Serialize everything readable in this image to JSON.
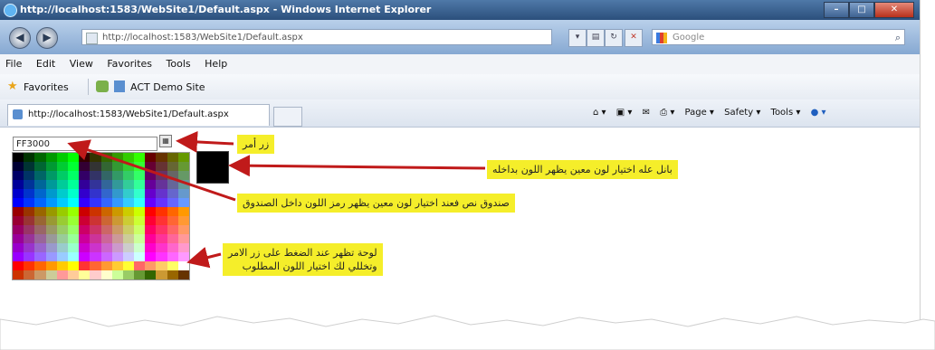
{
  "browser": {
    "title": "http://localhost:1583/WebSite1/Default.aspx - Windows Internet Explorer",
    "address": "http://localhost:1583/WebSite1/Default.aspx",
    "search_placeholder": "Google",
    "menu": [
      "File",
      "Edit",
      "View",
      "Favorites",
      "Tools",
      "Help"
    ],
    "favorites_label": "Favorites",
    "favorite_site": "ACT Demo Site",
    "tab_title": "http://localhost:1583/WebSite1/Default.aspx",
    "commands": [
      "Page ▾",
      "Safety ▾",
      "Tools ▾"
    ]
  },
  "page": {
    "color_value": "FF3000",
    "picker_button_label": "▦",
    "sample_color": "#000000",
    "palette_rows": [
      [
        "#000000",
        "#003300",
        "#006600",
        "#009900",
        "#00cc00",
        "#00ff00",
        "#330000",
        "#333300",
        "#336600",
        "#339900",
        "#33cc00",
        "#33ff00",
        "#660000",
        "#663300",
        "#666600",
        "#669900"
      ],
      [
        "#000033",
        "#003333",
        "#006633",
        "#009933",
        "#00cc33",
        "#00ff33",
        "#330033",
        "#333333",
        "#336633",
        "#339933",
        "#33cc33",
        "#33ff33",
        "#660033",
        "#663333",
        "#666633",
        "#669933"
      ],
      [
        "#000066",
        "#003366",
        "#006666",
        "#009966",
        "#00cc66",
        "#00ff66",
        "#330066",
        "#333366",
        "#336666",
        "#339966",
        "#33cc66",
        "#33ff66",
        "#660066",
        "#663366",
        "#666666",
        "#669966"
      ],
      [
        "#000099",
        "#003399",
        "#006699",
        "#009999",
        "#00cc99",
        "#00ff99",
        "#330099",
        "#333399",
        "#336699",
        "#339999",
        "#33cc99",
        "#33ff99",
        "#660099",
        "#663399",
        "#666699",
        "#669999"
      ],
      [
        "#0000cc",
        "#0033cc",
        "#0066cc",
        "#0099cc",
        "#00cccc",
        "#00ffcc",
        "#3300cc",
        "#3333cc",
        "#3366cc",
        "#3399cc",
        "#33cccc",
        "#33ffcc",
        "#6600cc",
        "#6633cc",
        "#6666cc",
        "#6699cc"
      ],
      [
        "#0000ff",
        "#0033ff",
        "#0066ff",
        "#0099ff",
        "#00ccff",
        "#00ffff",
        "#3300ff",
        "#3333ff",
        "#3366ff",
        "#3399ff",
        "#33ccff",
        "#33ffff",
        "#6600ff",
        "#6633ff",
        "#6666ff",
        "#6699ff"
      ],
      [
        "#990000",
        "#993300",
        "#996600",
        "#999900",
        "#99cc00",
        "#99ff00",
        "#cc0000",
        "#cc3300",
        "#cc6600",
        "#cc9900",
        "#cccc00",
        "#ccff00",
        "#ff0000",
        "#ff3300",
        "#ff6600",
        "#ff9900"
      ],
      [
        "#990033",
        "#993333",
        "#996633",
        "#999933",
        "#99cc33",
        "#99ff33",
        "#cc0033",
        "#cc3333",
        "#cc6633",
        "#cc9933",
        "#cccc33",
        "#ccff33",
        "#ff0033",
        "#ff3333",
        "#ff6633",
        "#ff9933"
      ],
      [
        "#990066",
        "#993366",
        "#996666",
        "#999966",
        "#99cc66",
        "#99ff66",
        "#cc0066",
        "#cc3366",
        "#cc6666",
        "#cc9966",
        "#cccc66",
        "#ccff66",
        "#ff0066",
        "#ff3366",
        "#ff6666",
        "#ff9966"
      ],
      [
        "#990099",
        "#993399",
        "#996699",
        "#999999",
        "#99cc99",
        "#99ff99",
        "#cc0099",
        "#cc3399",
        "#cc6699",
        "#cc9999",
        "#cccc99",
        "#ccff99",
        "#ff0099",
        "#ff3399",
        "#ff6699",
        "#ff9999"
      ],
      [
        "#9900cc",
        "#9933cc",
        "#9966cc",
        "#9999cc",
        "#99cccc",
        "#99ffcc",
        "#cc00cc",
        "#cc33cc",
        "#cc66cc",
        "#cc99cc",
        "#cccccc",
        "#ccffcc",
        "#ff00cc",
        "#ff33cc",
        "#ff66cc",
        "#ff99cc"
      ],
      [
        "#9900ff",
        "#9933ff",
        "#9966ff",
        "#9999ff",
        "#99ccff",
        "#99ffff",
        "#cc00ff",
        "#cc33ff",
        "#cc66ff",
        "#cc99ff",
        "#ccccff",
        "#ccffff",
        "#ff00ff",
        "#ff33ff",
        "#ff66ff",
        "#ff99ff"
      ],
      [
        "#ff0000",
        "#ff3300",
        "#ff6600",
        "#ff9900",
        "#ffcc00",
        "#ffff00",
        "#ff3333",
        "#ff6633",
        "#ff9933",
        "#ffcc33",
        "#ffff33",
        "#ff6666",
        "#ff9966",
        "#ffcc66",
        "#ffff66",
        "#ffffff"
      ],
      [
        "#cc3300",
        "#cc6633",
        "#cc9966",
        "#cccc99",
        "#ff9999",
        "#ffcc99",
        "#ffff99",
        "#ffcccc",
        "#ffffcc",
        "#ccff99",
        "#99cc66",
        "#669933",
        "#336600",
        "#cc9933",
        "#996600",
        "#663300"
      ]
    ],
    "callouts": {
      "button": "زر أمر",
      "sample": "بانل عله اختيار لون معين يظهر اللون بداخله",
      "textbox": "صندوق نص فعند اختيار لون معين يظهر رمز اللون داخل الصندوق",
      "palette_line1": "لوحة تظهر عند الضغط على زر الامر",
      "palette_line2": "وتخللي لك اختيار اللون المطلوب"
    }
  }
}
